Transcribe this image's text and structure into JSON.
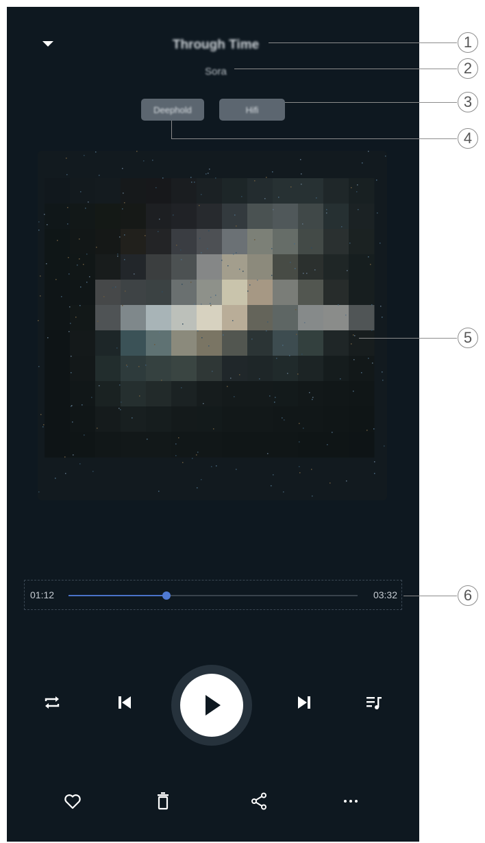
{
  "player": {
    "title": "Through Time",
    "artist": "Sora",
    "tags": [
      "Deephold",
      "Hifi"
    ],
    "current_time": "01:12",
    "total_time": "03:32",
    "progress_fraction": 0.34
  },
  "callouts": [
    "1",
    "2",
    "3",
    "4",
    "5",
    "6"
  ],
  "colors": {
    "background": "#0e1820",
    "accent": "#4f7ad4",
    "play_button": "#ffffff"
  },
  "icons": {
    "collapse": "chevron-down-icon",
    "repeat": "repeat-icon",
    "prev": "skip-previous-icon",
    "play": "play-icon",
    "next": "skip-next-icon",
    "queue": "queue-music-icon",
    "like": "heart-icon",
    "delete": "trash-icon",
    "share": "share-icon",
    "more": "more-horizontal-icon"
  }
}
